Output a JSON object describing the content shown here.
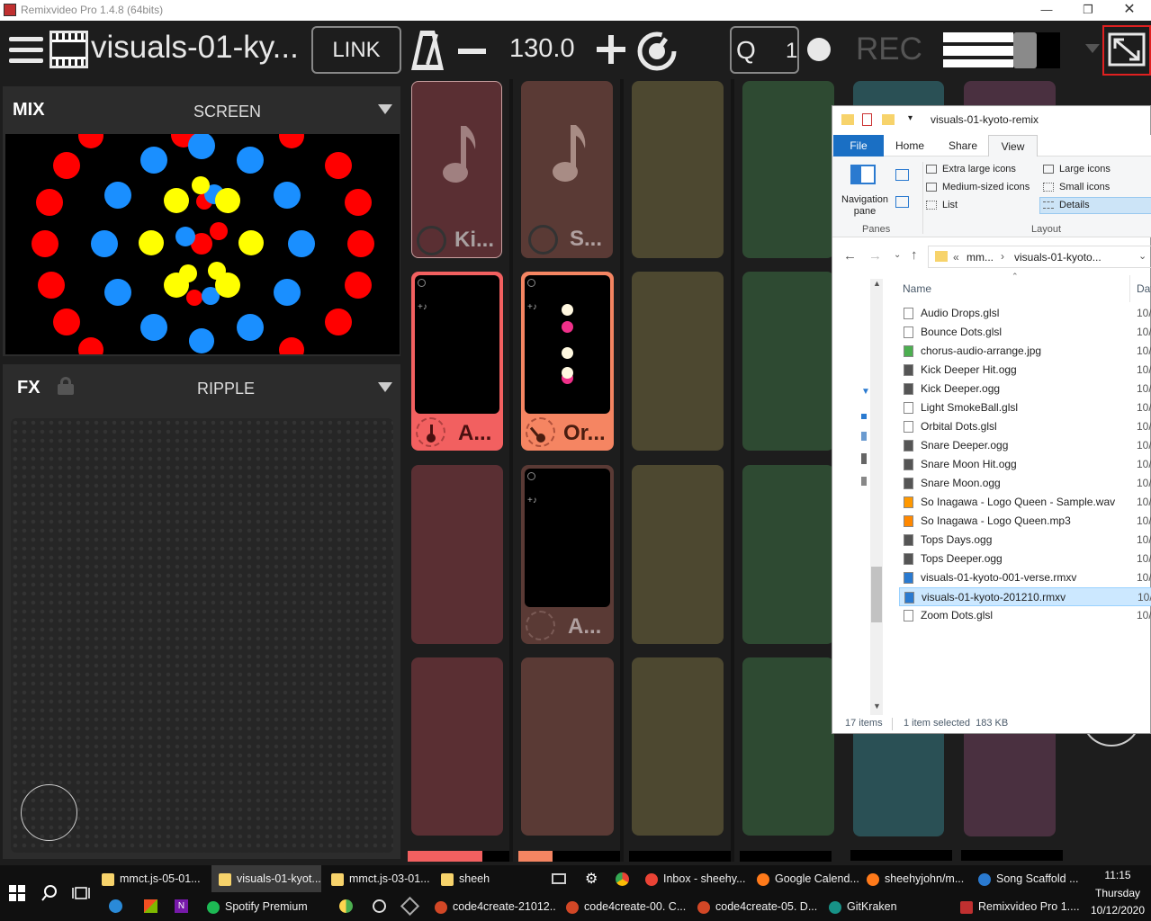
{
  "window": {
    "title": "Remixvideo Pro 1.4.8 (64bits)"
  },
  "toolbar": {
    "project_name": "visuals-01-ky...",
    "link_label": "LINK",
    "bpm": "130.0",
    "q_label": "Q",
    "q_value": "1",
    "rec_label": "REC"
  },
  "mix": {
    "label": "MIX",
    "output": "SCREEN"
  },
  "fx": {
    "label": "FX",
    "effect": "RIPPLE"
  },
  "pads": [
    {
      "label": "Ki...",
      "color": "#5a2f33"
    },
    {
      "label": "S...",
      "color": "#5a3a35"
    },
    {
      "label": "A...",
      "color": "#f26060"
    },
    {
      "label": "Or...",
      "color": "#f58562"
    },
    {
      "label": "A...",
      "color": "#5a3a35"
    }
  ],
  "explorer": {
    "title": "visuals-01-kyoto-remix",
    "tabs": [
      "File",
      "Home",
      "Share",
      "View"
    ],
    "ribbon": {
      "navigation_pane": "Navigation pane",
      "panes_group": "Panes",
      "layout_group": "Layout",
      "layout_options": [
        "Extra large icons",
        "Large icons",
        "Medium-sized icons",
        "Small icons",
        "List",
        "Details"
      ]
    },
    "breadcrumb": [
      "«",
      "mm...",
      "visuals-01-kyoto..."
    ],
    "column_name": "Name",
    "column_date": "Dat",
    "files": [
      {
        "name": "Audio Drops.glsl",
        "date": "10/",
        "icon": "doc"
      },
      {
        "name": "Bounce Dots.glsl",
        "date": "10/",
        "icon": "doc"
      },
      {
        "name": "chorus-audio-arrange.jpg",
        "date": "10/",
        "icon": "img"
      },
      {
        "name": "Kick Deeper Hit.ogg",
        "date": "10/",
        "icon": "audio"
      },
      {
        "name": "Kick Deeper.ogg",
        "date": "10/",
        "icon": "audio"
      },
      {
        "name": "Light SmokeBall.glsl",
        "date": "10/",
        "icon": "doc"
      },
      {
        "name": "Orbital Dots.glsl",
        "date": "10/",
        "icon": "doc"
      },
      {
        "name": "Snare Deeper.ogg",
        "date": "10/",
        "icon": "audio"
      },
      {
        "name": "Snare Moon Hit.ogg",
        "date": "10/",
        "icon": "audio"
      },
      {
        "name": "Snare Moon.ogg",
        "date": "10/",
        "icon": "audio"
      },
      {
        "name": "So Inagawa - Logo Queen - Sample.wav",
        "date": "10/",
        "icon": "wav"
      },
      {
        "name": "So Inagawa - Logo Queen.mp3",
        "date": "10/",
        "icon": "vlc"
      },
      {
        "name": "Tops Days.ogg",
        "date": "10/",
        "icon": "audio"
      },
      {
        "name": "Tops Deeper.ogg",
        "date": "10/",
        "icon": "audio"
      },
      {
        "name": "visuals-01-kyoto-001-verse.rmxv",
        "date": "10/",
        "icon": "rmx"
      },
      {
        "name": "visuals-01-kyoto-201210.rmxv",
        "date": "10/",
        "icon": "rmx",
        "selected": true
      },
      {
        "name": "Zoom Dots.glsl",
        "date": "10/",
        "icon": "doc"
      }
    ],
    "status_items": "17 items",
    "status_selected": "1 item selected  183 KB"
  },
  "taskbar": {
    "row1": [
      "mmct.js-05-01...",
      "visuals-01-kyot...",
      "mmct.js-03-01...",
      "sheeh",
      "Inbox - sheehy...",
      "Google Calend...",
      "sheehyjohn/m...",
      "Song Scaffold ..."
    ],
    "row2": [
      "Spotify Premium",
      "code4create-21012...",
      "code4create-00. C...",
      "code4create-05. D...",
      "GitKraken",
      "Remixvideo Pro 1...."
    ],
    "time": "11:15",
    "day": "Thursday",
    "date": "10/12/2020"
  },
  "colors": {
    "dot_red": "#ff0000",
    "dot_blue": "#1a8fff",
    "dot_yellow": "#ffff00",
    "accent_red": "#f26060",
    "accent_orange": "#f58562"
  }
}
